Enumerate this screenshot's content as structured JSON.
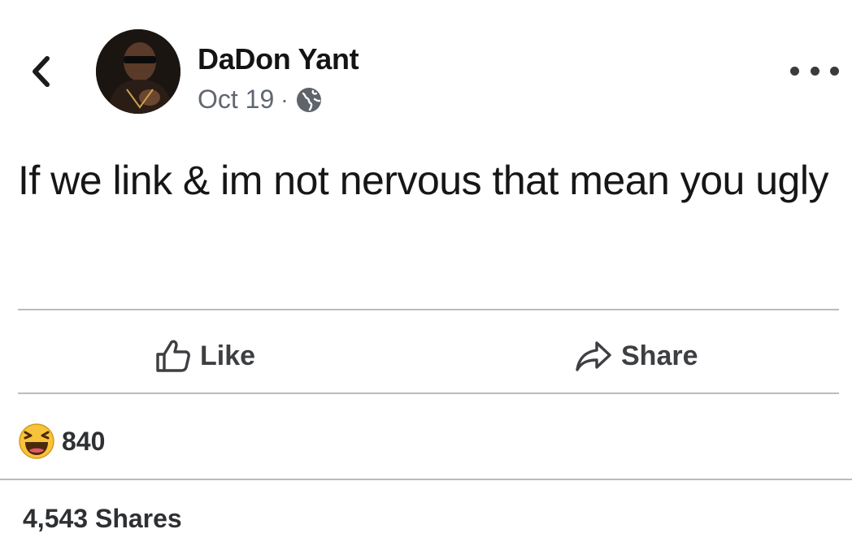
{
  "post": {
    "author": "DaDon Yant",
    "date": "Oct 19",
    "separator": "·",
    "privacy_icon": "globe-icon",
    "text": "If we link & im not nervous that mean you ugly",
    "actions": {
      "like_label": "Like",
      "share_label": "Share"
    },
    "reaction_icon": "laugh-emoji-icon",
    "reaction_count": "840",
    "shares_text": "4,543 Shares"
  },
  "colors": {
    "text_primary": "#1c1e21",
    "text_secondary": "#606770",
    "divider": "#b8bbbf",
    "emoji_yellow": "#f7c33b"
  }
}
